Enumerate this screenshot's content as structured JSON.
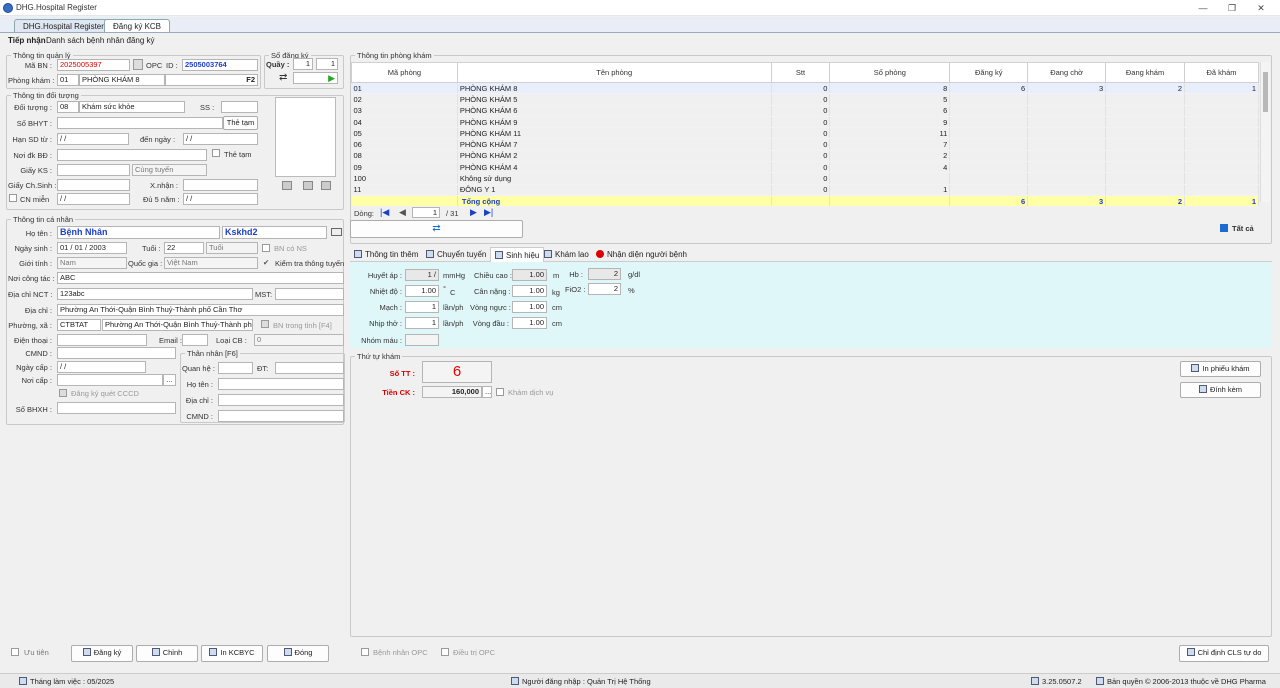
{
  "window": {
    "title": "DHG.Hospital Register"
  },
  "tabs": [
    "DHG.Hospital Register",
    "Đăng ký KCB"
  ],
  "subtabs": [
    "Tiếp nhận",
    "Danh sách bệnh nhân đăng ký"
  ],
  "quanly": {
    "legend": "Thông tin quản lý",
    "ma_bn_label": "Mã BN :",
    "ma_bn": "2025005397",
    "opc": "OPC",
    "id_label": "ID :",
    "id": "2505003764",
    "phong_label": "Phòng khám :",
    "phong_code": "01",
    "phong_name": "PHÒNG KHÁM 8",
    "f2": "F2"
  },
  "sodangky": {
    "legend": "Số đăng ký",
    "quay_label": "Quầy :",
    "quay1": "1",
    "quay2": "1"
  },
  "doituong": {
    "legend": "Thông tin đối tượng",
    "doi_tuong_label": "Đối tượng :",
    "doi_tuong_code": "08",
    "doi_tuong_name": "Khám sức khỏe",
    "ss_label": "SS :",
    "so_bhyt_label": "Số BHYT :",
    "the_tam_btn": "Thẻ tạm",
    "han_sd_label": "Hạn SD từ :",
    "den_ngay_label": "đến ngày :",
    "date_blank": "/ /",
    "noi_dk_label": "Nơi đk BĐ :",
    "the_tam_chk": "Thẻ tạm",
    "giay_ks_label": "Giấy KS :",
    "cung_tuyen": "Cùng tuyến",
    "giay_cs_label": "Giấy Ch.Sinh :",
    "xnhan_label": "X.nhận :",
    "cn_mien_label": "CN miễn",
    "du5nam_label": "Đủ 5 năm :"
  },
  "canhan": {
    "legend": "Thông tin cá nhân",
    "ho_ten_label": "Họ tên :",
    "ho_ten": "Bệnh Nhân",
    "ksk": "Kskhd2",
    "ngay_sinh_label": "Ngày sinh :",
    "ngay_sinh": "01 / 01 / 2003",
    "tuoi_label": "Tuổi :",
    "tuoi": "22",
    "tuoi_unit": "Tuổi",
    "bn_co_ns": "BN có NS",
    "gioi_tinh_label": "Giới tính :",
    "gioi_tinh": "Nam",
    "quoc_gia_label": "Quốc gia :",
    "quoc_gia": "Việt Nam",
    "kiem_tra": "Kiểm tra thông tuyến",
    "noi_ct_label": "Nơi công tác :",
    "noi_ct": "ABC",
    "dia_chi_nct_label": "Địa chỉ NCT :",
    "dia_chi_nct": "123abc",
    "mst_label": "MST:",
    "dia_chi_label": "Địa chỉ :",
    "dia_chi": "Phường An Thới-Quận Bình Thuỷ-Thành phố Cần Thơ",
    "phuong_label": "Phường, xã :",
    "phuong_code": "CTBTAT",
    "phuong_name": "Phường An Thới-Quận Bình Thuỷ-Thành phố C",
    "bn_trong_tinh": "BN trong tỉnh [F4]",
    "dien_thoai_label": "Điện thoại :",
    "email_label": "Email :",
    "loai_cb_label": "Loại CB :",
    "loai_cb": "0",
    "cmnd_label": "CMND :",
    "than_nhan_legend": "Thân nhân [F6]",
    "ngay_cap_label": "Ngày cấp :",
    "quan_he_label": "Quan hệ :",
    "dt_label": "ĐT:",
    "noi_cap_label": "Nơi cấp :",
    "tn_ho_ten_label": "Họ tên :",
    "dk_cccd": "Đăng ký quét CCCD",
    "tn_dia_chi_label": "Địa chỉ :",
    "so_bhxh_label": "Số BHXH :",
    "tn_cmnd_label": "CMND :"
  },
  "phongkham": {
    "legend": "Thông tin phòng khám",
    "headers": [
      "Mã phòng",
      "Tên phòng",
      "Stt",
      "Số phòng",
      "Đăng ký",
      "Đang chờ",
      "Đang khám",
      "Đã khám"
    ],
    "rows": [
      [
        "01",
        "PHÒNG KHÁM 8",
        "0",
        "8",
        "6",
        "3",
        "2",
        "1"
      ],
      [
        "02",
        "PHÒNG KHÁM 5",
        "0",
        "5",
        "",
        "",
        "",
        ""
      ],
      [
        "03",
        "PHÒNG KHÁM 6",
        "0",
        "6",
        "",
        "",
        "",
        ""
      ],
      [
        "04",
        "PHÒNG KHÁM 9",
        "0",
        "9",
        "",
        "",
        "",
        ""
      ],
      [
        "05",
        "PHÒNG KHÁM 11",
        "0",
        "11",
        "",
        "",
        "",
        ""
      ],
      [
        "06",
        "PHÒNG KHÁM 7",
        "0",
        "7",
        "",
        "",
        "",
        ""
      ],
      [
        "08",
        "PHÒNG KHÁM 2",
        "0",
        "2",
        "",
        "",
        "",
        ""
      ],
      [
        "09",
        "PHÒNG KHÁM 4",
        "0",
        "4",
        "",
        "",
        "",
        ""
      ],
      [
        "100",
        "Không sử dụng",
        "0",
        "",
        "",
        "",
        "",
        ""
      ],
      [
        "11",
        "ĐÔNG Y 1",
        "0",
        "1",
        "",
        "",
        "",
        ""
      ]
    ],
    "total": [
      "",
      "Tổng cộng",
      "",
      "",
      "6",
      "3",
      "2",
      "1"
    ],
    "dong_label": "Dòng:",
    "page": "1",
    "page_total": "/ 31",
    "tat_ca": "Tất cả"
  },
  "subtabs2": [
    "Thông tin thêm",
    "Chuyển tuyến",
    "Sinh hiệu",
    "Khám lao",
    "Nhận diện người bệnh"
  ],
  "sinhhieu": {
    "huyet_ap_label": "Huyết áp :",
    "huyet_ap": "1 /",
    "mmhg": "mmHg",
    "chieu_cao_label": "Chiều cao :",
    "chieu_cao": "1.00",
    "m": "m",
    "hb_label": "Hb :",
    "hb": "2",
    "gdl": "g/dl",
    "nhiet_do_label": "Nhiệt độ :",
    "nhiet_do": "1.00",
    "deg": "°",
    "c": "C",
    "can_nang_label": "Cân nặng :",
    "can_nang": "1.00",
    "kg": "kg",
    "fio2_label": "FiO2 :",
    "fio2": "2",
    "pct": "%",
    "mach_label": "Mạch :",
    "mach": "1",
    "lanph": "lần/ph",
    "vong_nguc_label": "Vòng ngực :",
    "vong_nguc": "1.00",
    "cm": "cm",
    "nhip_tho_label": "Nhịp thở :",
    "nhip_tho": "1",
    "vong_dau_label": "Vòng đầu :",
    "vong_dau": "1.00",
    "nhom_mau_label": "Nhóm máu :"
  },
  "thutu": {
    "legend": "Thứ tự khám",
    "so_tt_label": "Số TT :",
    "so_tt": "6",
    "tien_ck_label": "Tiền CK :",
    "tien_ck": "160,000",
    "dots": "...",
    "kham_dv": "Khám dịch vụ",
    "in_phieu": "In phiếu khám",
    "dinh_kem": "Đính kèm"
  },
  "bottom": {
    "uu_tien": "Ưu tiên",
    "dang_ky": "Đăng ký",
    "chinh": "Chỉnh",
    "in_kcbyc": "In KCBYC",
    "dong": "Đóng",
    "bn_opc": "Bệnh nhân OPC",
    "dieu_tri_opc": "Điều trị OPC",
    "chi_dinh": "Chỉ định CLS tự do"
  },
  "status": {
    "thang": "Tháng làm việc : 05/2025",
    "nguoi": "Người đăng nhập : Quản Trị Hệ Thống",
    "version": "3.25.0507.2",
    "ban_quyen": "Bản quyền © 2006-2013 thuộc về DHG Pharma"
  }
}
